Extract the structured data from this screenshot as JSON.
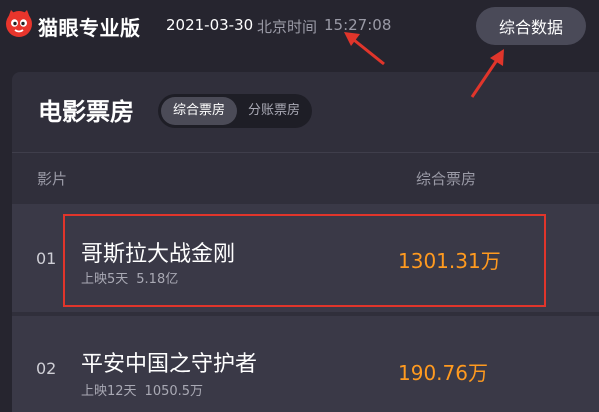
{
  "header": {
    "brand": "猫眼专业版",
    "date": "2021-03-30",
    "clock_label": "北京时间",
    "clock_time": "15:27:08",
    "data_button_label": "综合数据"
  },
  "panel": {
    "title": "电影票房",
    "toggle": {
      "active_label": "综合票房",
      "inactive_label": "分账票房"
    },
    "columns": {
      "film": "影片",
      "box_office": "综合票房"
    },
    "rows": [
      {
        "rank": "01",
        "name": "哥斯拉大战金刚",
        "days": "上映5天",
        "total": "5.18亿",
        "gross": "1301.31万"
      },
      {
        "rank": "02",
        "name": "平安中国之守护者",
        "days": "上映12天",
        "total": "1050.5万",
        "gross": "190.76万"
      }
    ]
  },
  "colors": {
    "background": "#26252f",
    "panel": "#302f3b",
    "row": "#3a3947",
    "gross": "#ff9a1f",
    "annotation_red": "#e0352b"
  },
  "icons": {
    "logo": "cat-logo-icon"
  }
}
